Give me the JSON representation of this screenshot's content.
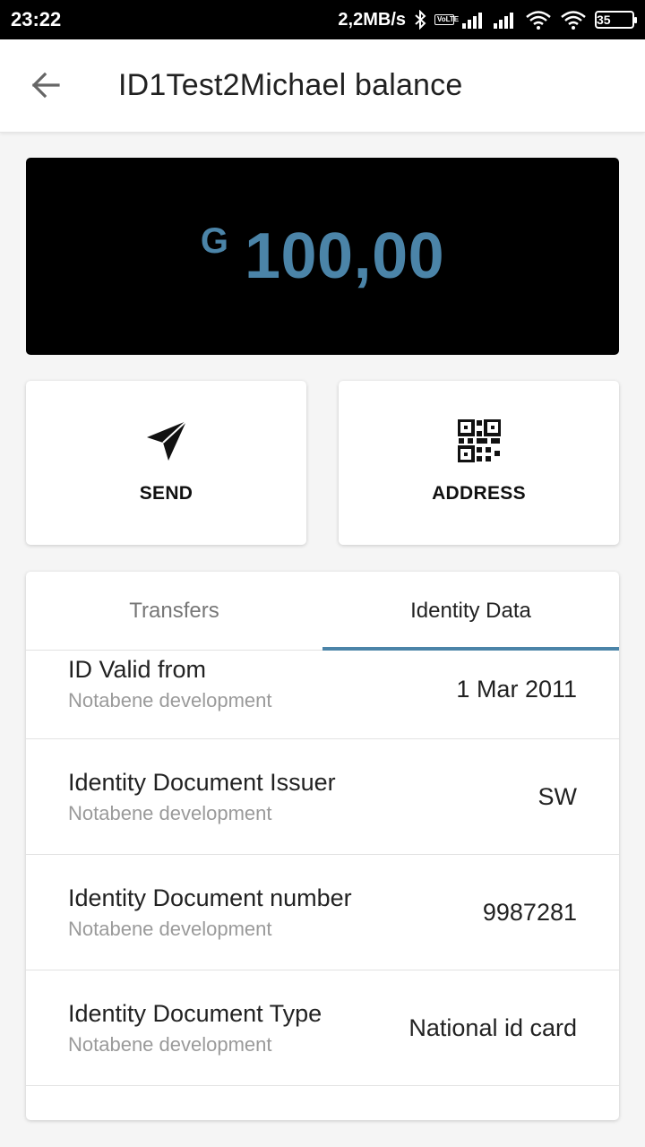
{
  "status_bar": {
    "time": "23:22",
    "speed": "2,2MB/s",
    "volte": "VoLTE",
    "battery": "35",
    "icons": [
      "bluetooth-icon",
      "volte-icon",
      "signal-icon",
      "signal-icon",
      "wifi-icon",
      "wifi-icon",
      "battery-icon"
    ]
  },
  "app_bar": {
    "title": "ID1Test2Michael balance",
    "back_icon": "arrow-left-icon"
  },
  "balance": {
    "currency": "G",
    "amount": "100,00",
    "accent_color": "#4b84a8"
  },
  "actions": {
    "send": {
      "label": "SEND",
      "icon": "send-icon"
    },
    "address": {
      "label": "ADDRESS",
      "icon": "qr-code-icon"
    }
  },
  "tabs": [
    {
      "label": "Transfers",
      "active": false
    },
    {
      "label": "Identity Data",
      "active": true
    }
  ],
  "identity_rows": [
    {
      "name": "ID Valid from",
      "source": "Notabene development",
      "value": "1 Mar 2011"
    },
    {
      "name": "Identity Document Issuer",
      "source": "Notabene development",
      "value": "SW"
    },
    {
      "name": "Identity Document number",
      "source": "Notabene development",
      "value": "9987281"
    },
    {
      "name": "Identity Document Type",
      "source": "Notabene development",
      "value": "National id card"
    }
  ]
}
